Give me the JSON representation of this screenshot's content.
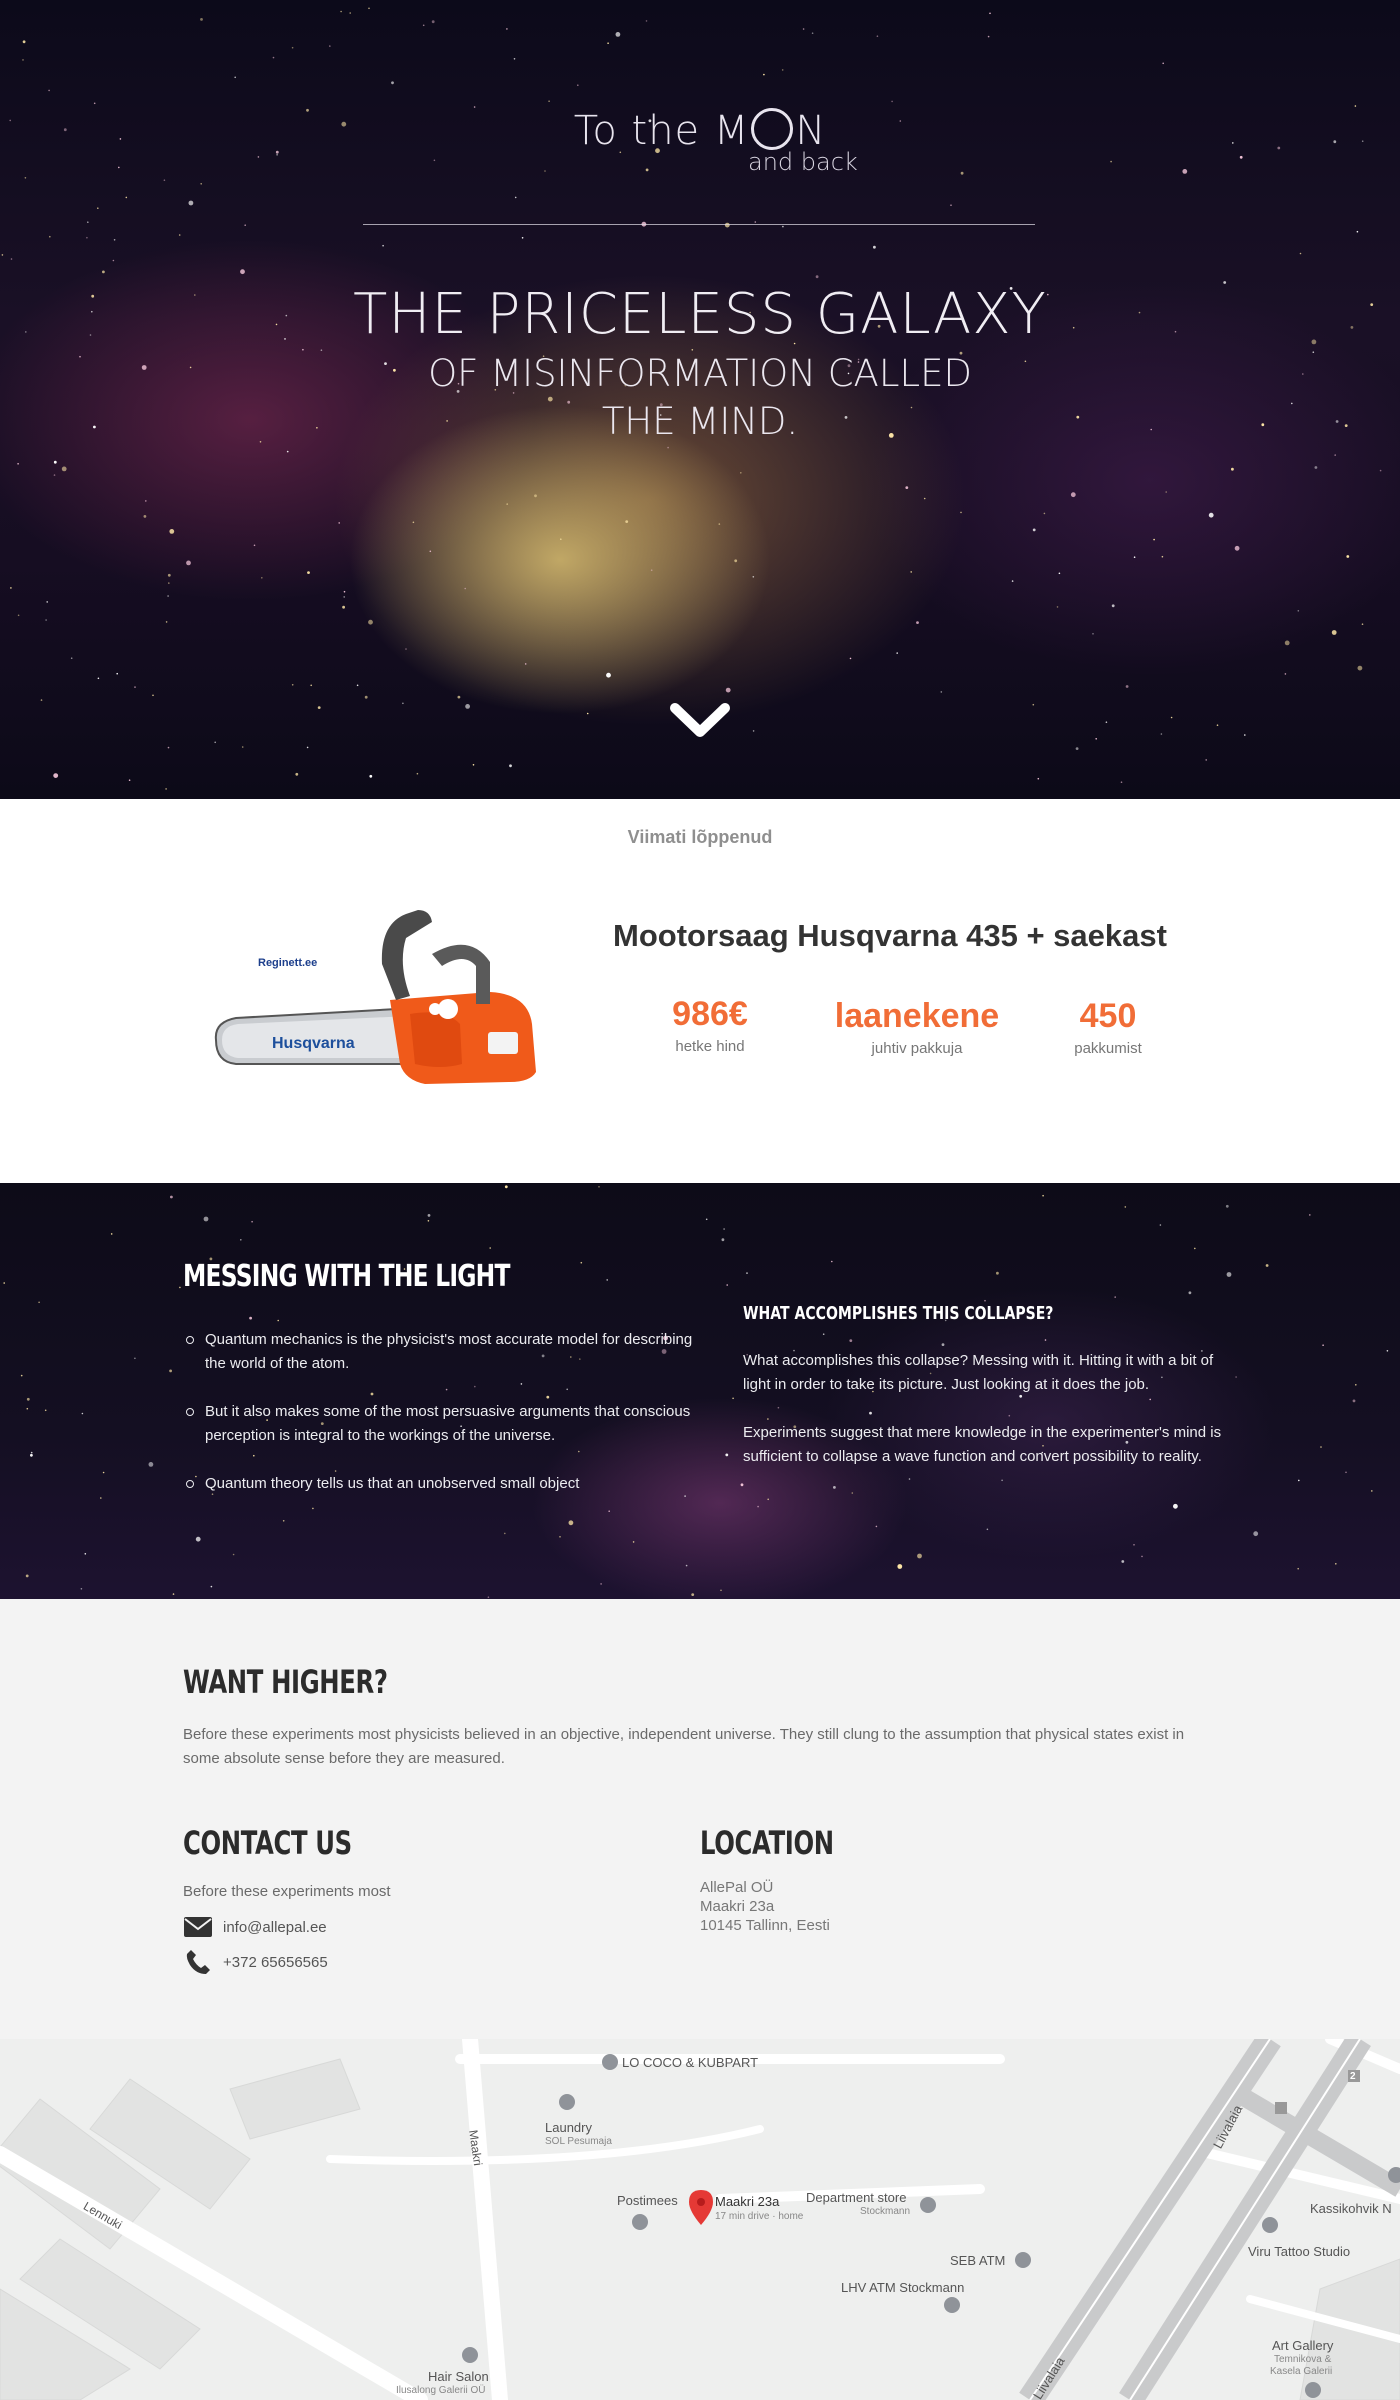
{
  "hero": {
    "logo_prefix": "To the M",
    "logo_suffix": "N",
    "logo_sub": "and back",
    "headline": "THE PRICELESS GALAXY",
    "subheadline_line1": "OF MISINFORMATION CALLED",
    "subheadline_line2": "THE MIND."
  },
  "auction": {
    "section_label": "Viimati lõppenud",
    "product_title": "Mootorsaag Husqvarna 435 + saekast",
    "product_brand_text": "Reginett.ee",
    "product_saw_text": "Husqvarna",
    "stats": [
      {
        "value": "986€",
        "label": "hetke hind"
      },
      {
        "value": "laanekene",
        "label": "juhtiv pakkuja"
      },
      {
        "value": "450",
        "label": "pakkumist"
      }
    ],
    "accent_color": "#f16d37"
  },
  "light": {
    "title": "MESSING WITH THE LIGHT",
    "bullets": [
      "Quantum mechanics is the physicist's most accurate model for describing the world of the atom.",
      "But it also makes some of the most persuasive arguments that conscious perception is integral to the workings of the universe.",
      "Quantum theory tells us that an unobserved small object"
    ],
    "subtitle": "WHAT ACCOMPLISHES THIS COLLAPSE?",
    "para1": "What accomplishes this collapse? Messing with it. Hitting it with a bit of light in order to take its picture. Just looking at it does the job.",
    "para2": "Experiments suggest that mere knowledge in the experimenter's mind is sufficient to collapse a wave function and convert possibility to reality."
  },
  "info": {
    "higher_title": "WANT HIGHER?",
    "higher_text": "Before these experiments most physicists believed in an objective, independent universe. They still clung to the assumption that physical states exist in some absolute sense before they are measured.",
    "contact_title": "CONTACT US",
    "contact_text": "Before these experiments most",
    "email": "info@allepal.ee",
    "phone": "+372 65656565",
    "location_title": "LOCATION",
    "company": "AllePal OÜ",
    "street": "Maakri 23a",
    "city": "10145 Tallinn, Eesti"
  },
  "map": {
    "labels": {
      "lo_coco": "LO COCO & KUBPART",
      "laundry": "Laundry",
      "laundry_sub": "SOL Pesumaja",
      "maakri_street": "Maakri",
      "lennuki_street": "Lennuki",
      "postimees": "Postimees",
      "pin_title": "Maakri 23a",
      "pin_sub": "17 min drive · home",
      "dept_store": "Department store",
      "dept_store_sub": "Stockmann",
      "seb_atm": "SEB ATM",
      "lhv_atm": "LHV ATM Stockmann",
      "liivalaia_1": "Liivalaia",
      "liivalaia_2": "Liivalaia",
      "kassikohvik": "Kassikohvik N",
      "viru_tattoo": "Viru Tattoo Studio",
      "art_gallery": "Art Gallery",
      "art_gallery_sub1": "Temnikova &",
      "art_gallery_sub2": "Kasela Galerii",
      "hair_salon": "Hair Salon",
      "hair_salon_sub": "Ilusalong Galerii OÜ",
      "badge_2": "2"
    }
  }
}
